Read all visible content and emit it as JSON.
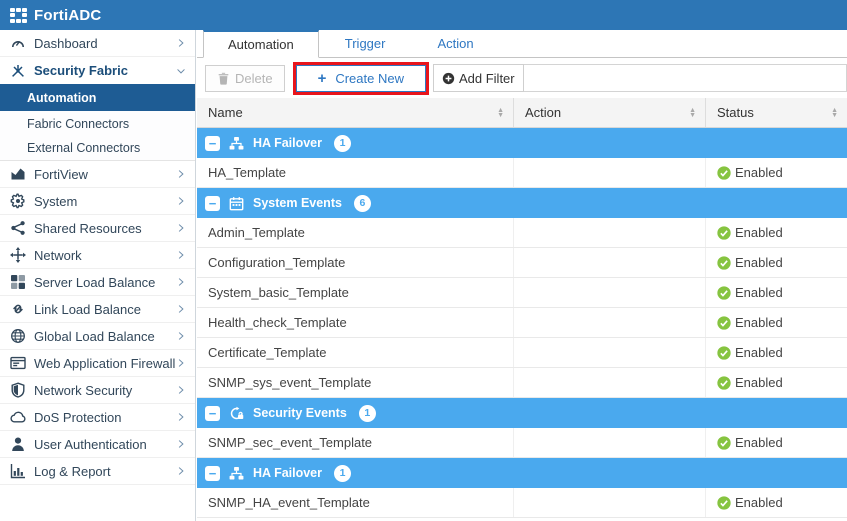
{
  "app": {
    "title": "FortiADC"
  },
  "colors": {
    "topbar_blue": "#2d76b5",
    "accent_blue": "#2e77c2",
    "nav_selected_blue": "#1e5c94",
    "group_row_blue": "#4aa9ee",
    "enabled_green": "#86c440",
    "annotation_red": "#e8151c"
  },
  "sidebar": {
    "items": [
      {
        "label": "Dashboard",
        "icon": "dashboard-icon",
        "chevron": "right"
      },
      {
        "label": "Security Fabric",
        "icon": "security-fabric-icon",
        "chevron": "down",
        "expanded": true,
        "children": [
          {
            "label": "Automation",
            "selected": true
          },
          {
            "label": "Fabric Connectors"
          },
          {
            "label": "External Connectors",
            "last": true
          }
        ]
      },
      {
        "label": "FortiView",
        "icon": "fortiview-icon",
        "chevron": "right"
      },
      {
        "label": "System",
        "icon": "gear-icon",
        "chevron": "right"
      },
      {
        "label": "Shared Resources",
        "icon": "share-icon",
        "chevron": "right"
      },
      {
        "label": "Network",
        "icon": "move-arrows-icon",
        "chevron": "right"
      },
      {
        "label": "Server Load Balance",
        "icon": "server-load-balance-icon",
        "chevron": "right"
      },
      {
        "label": "Link Load Balance",
        "icon": "link-icon",
        "chevron": "right"
      },
      {
        "label": "Global Load Balance",
        "icon": "globe-icon",
        "chevron": "right"
      },
      {
        "label": "Web Application Firewall",
        "icon": "waf-window-icon",
        "chevron": "right"
      },
      {
        "label": "Network Security",
        "icon": "shield-icon",
        "chevron": "right"
      },
      {
        "label": "DoS Protection",
        "icon": "cloud-icon",
        "chevron": "right"
      },
      {
        "label": "User Authentication",
        "icon": "user-icon",
        "chevron": "right"
      },
      {
        "label": "Log & Report",
        "icon": "bar-chart-icon",
        "chevron": "right"
      }
    ]
  },
  "tabs": [
    {
      "label": "Automation",
      "active": true
    },
    {
      "label": "Trigger",
      "active": false
    },
    {
      "label": "Action",
      "active": false
    }
  ],
  "toolbar": {
    "delete_label": "Delete",
    "create_new_label": "Create New",
    "create_new_plus": "+",
    "add_filter_label": "Add Filter"
  },
  "table": {
    "columns": [
      {
        "key": "name",
        "label": "Name"
      },
      {
        "key": "action",
        "label": "Action"
      },
      {
        "key": "status",
        "label": "Status"
      }
    ],
    "groups": [
      {
        "label": "HA Failover",
        "count": "1",
        "icon": "sitemap-icon",
        "collapse_glyph": "−",
        "rows": [
          {
            "name": "HA_Template",
            "action": "",
            "status": "Enabled"
          }
        ]
      },
      {
        "label": "System Events",
        "count": "6",
        "icon": "calendar-icon",
        "collapse_glyph": "−",
        "rows": [
          {
            "name": "Admin_Template",
            "action": "",
            "status": "Enabled"
          },
          {
            "name": "Configuration_Template",
            "action": "",
            "status": "Enabled"
          },
          {
            "name": "System_basic_Template",
            "action": "",
            "status": "Enabled"
          },
          {
            "name": "Health_check_Template",
            "action": "",
            "status": "Enabled"
          },
          {
            "name": "Certificate_Template",
            "action": "",
            "status": "Enabled"
          },
          {
            "name": "SNMP_sys_event_Template",
            "action": "",
            "status": "Enabled"
          }
        ]
      },
      {
        "label": "Security Events",
        "count": "1",
        "icon": "security-scan-icon",
        "collapse_glyph": "−",
        "rows": [
          {
            "name": "SNMP_sec_event_Template",
            "action": "",
            "status": "Enabled"
          }
        ]
      },
      {
        "label": "HA Failover",
        "count": "1",
        "icon": "sitemap-icon",
        "collapse_glyph": "−",
        "rows": [
          {
            "name": "SNMP_HA_event_Template",
            "action": "",
            "status": "Enabled"
          }
        ]
      }
    ]
  }
}
